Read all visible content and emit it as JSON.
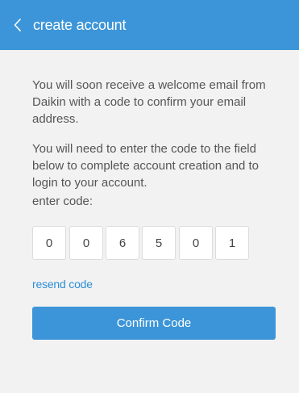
{
  "header": {
    "title": "create account",
    "back_icon": "chevron-left-icon",
    "background_color": "#3c95d8"
  },
  "main": {
    "paragraph1": "You will soon receive a welcome email from Daikin with a code to confirm your email address.",
    "paragraph2": "You will need to enter the code to the field below to complete account creation and to login to your account.",
    "code_label": "enter code:",
    "code_digits": [
      "0",
      "0",
      "6",
      "5",
      "0",
      "1"
    ],
    "resend_label": "resend code",
    "confirm_label": "Confirm Code",
    "accent_color": "#3c95d8",
    "link_color": "#2f8fd6"
  }
}
